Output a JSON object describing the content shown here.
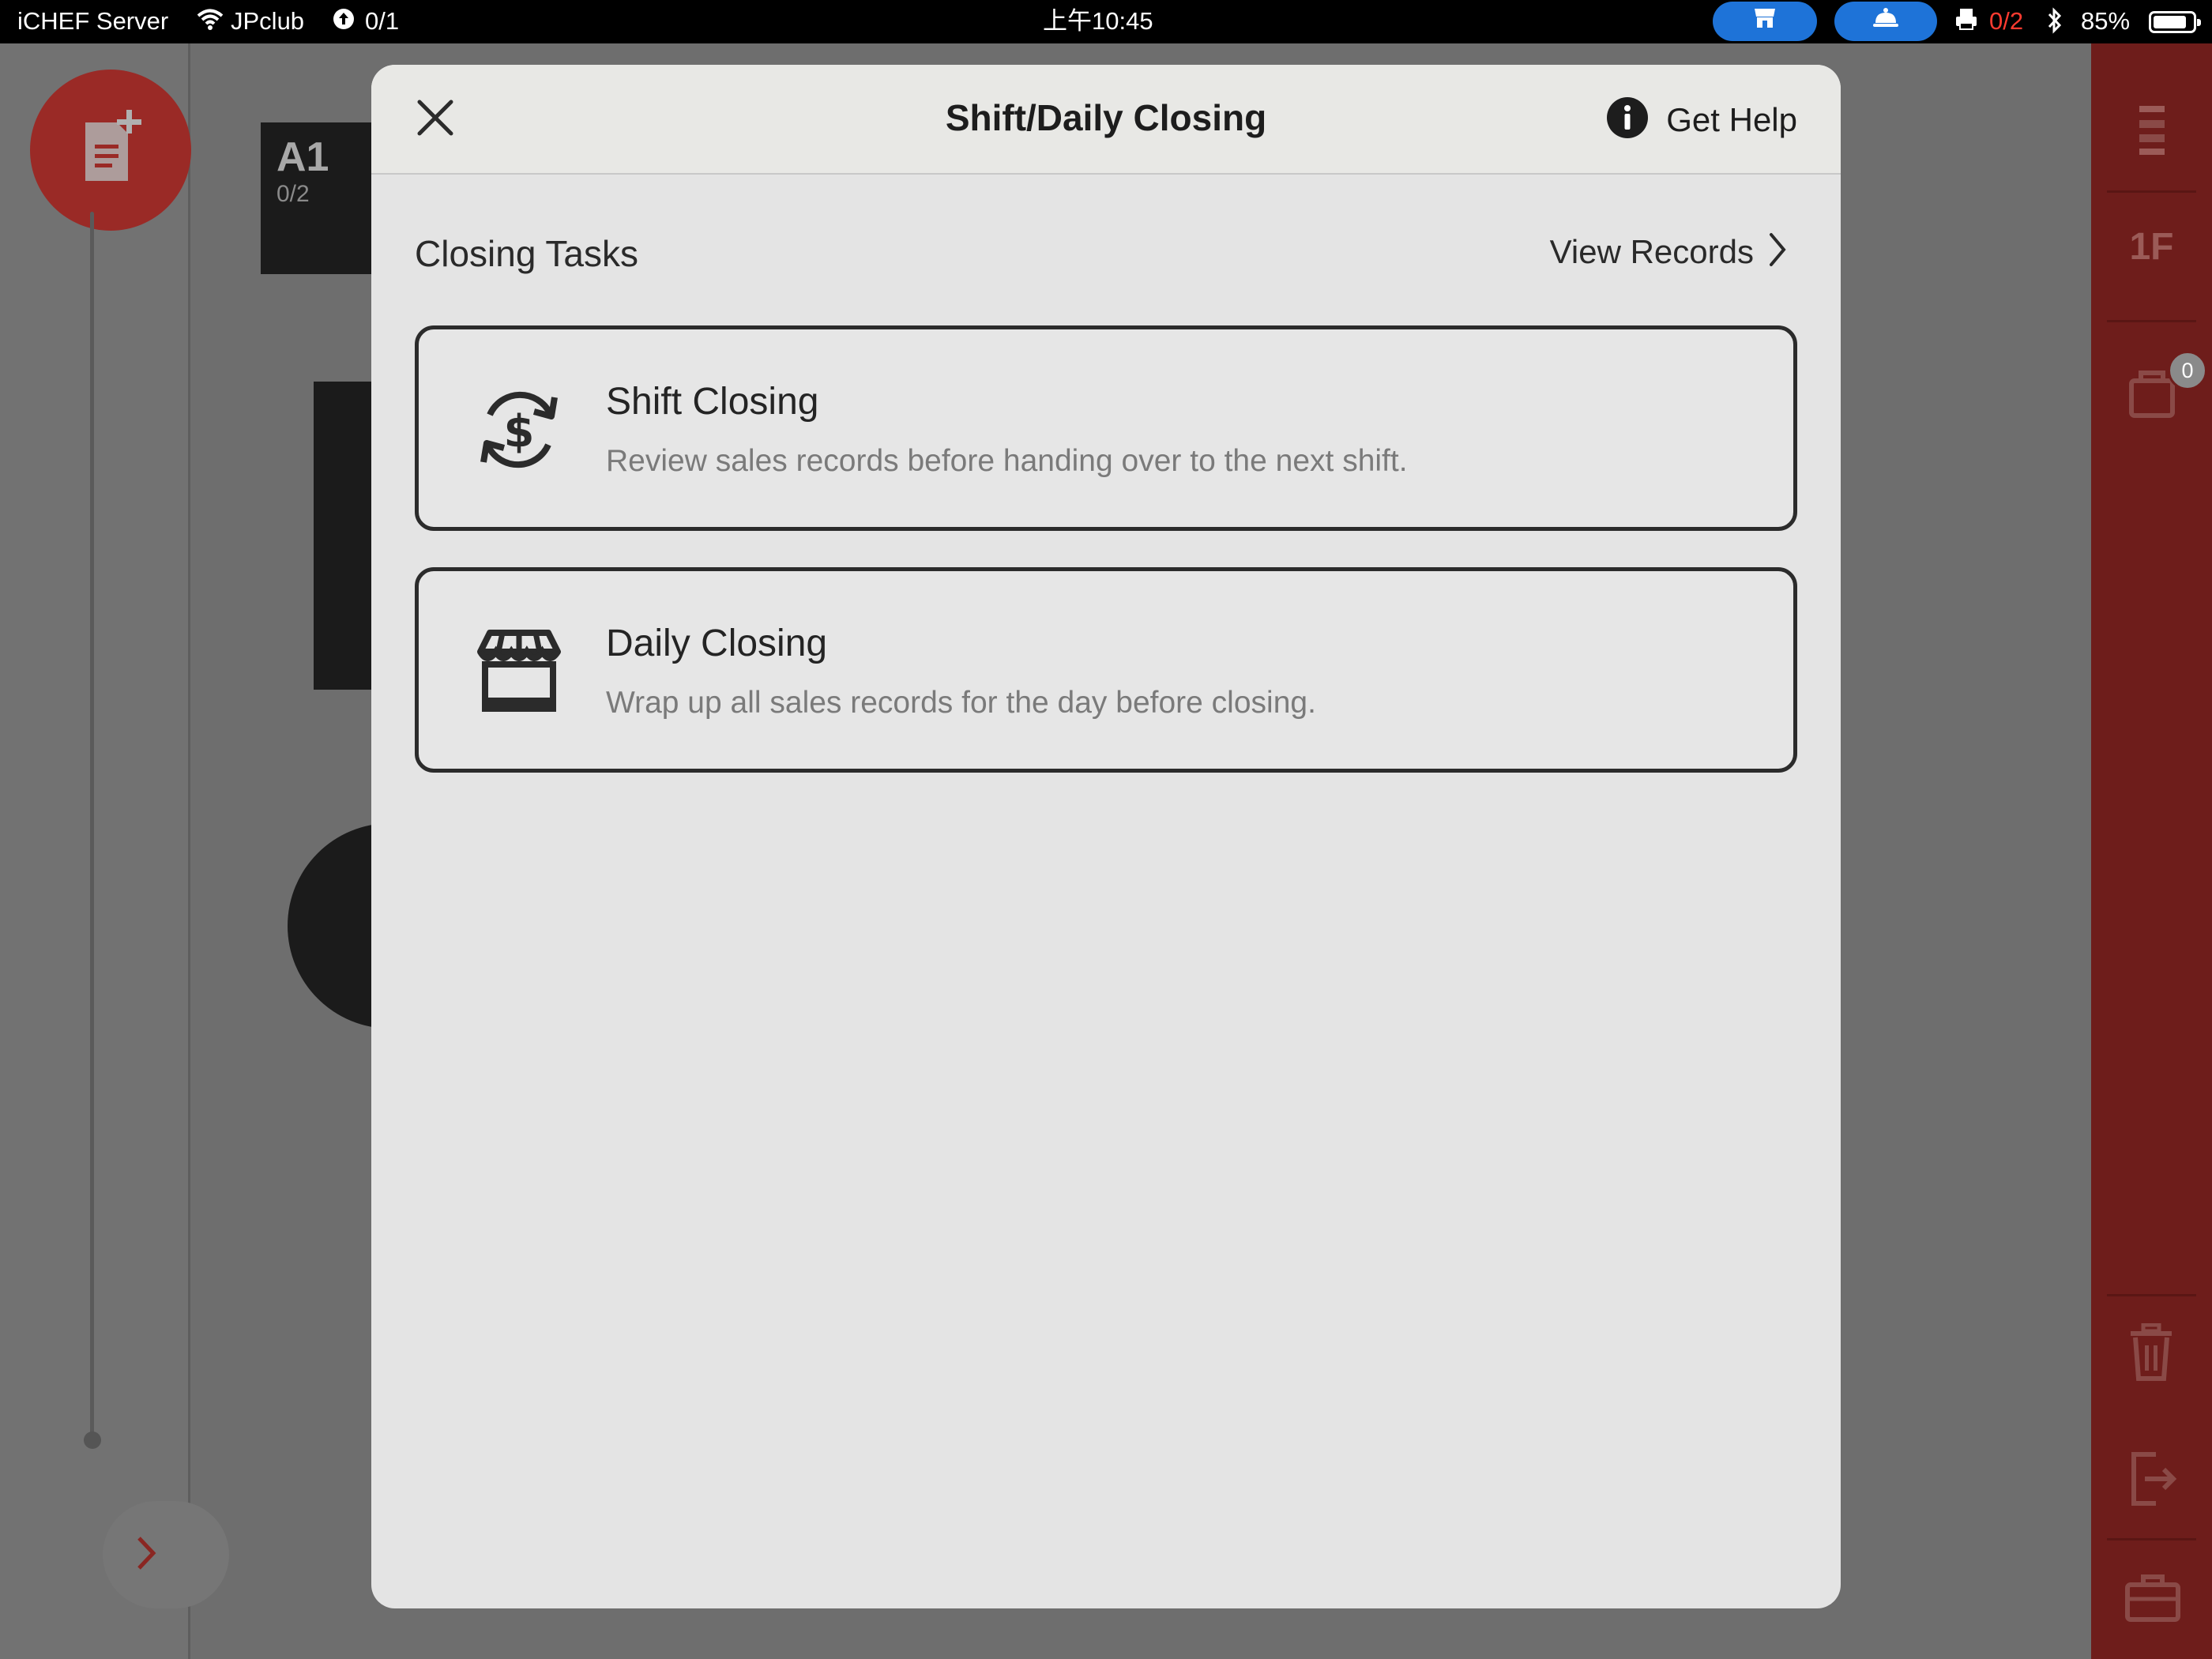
{
  "status_bar": {
    "app_name": "iCHEF Server",
    "network": "JPclub",
    "sync_count": "0/1",
    "time": "上午10:45",
    "printer_count": "0/2",
    "battery": "85%",
    "battery_level": 0.85,
    "accent_red": "#ff3b30",
    "pill_color": "#1e73d8"
  },
  "background": {
    "table_a1_name": "A1",
    "table_a1_count": "0/2",
    "floor": "1F",
    "cart_badge": "0",
    "accent_color": "#9a2a26"
  },
  "modal": {
    "title": "Shift/Daily Closing",
    "help_label": "Get Help",
    "section_title": "Closing Tasks",
    "view_records_label": "View Records",
    "tasks": [
      {
        "title": "Shift Closing",
        "description": "Review sales records before handing over to the next shift.",
        "icon": "dollar-cycle-icon"
      },
      {
        "title": "Daily Closing",
        "description": "Wrap up all sales records for the day before closing.",
        "icon": "storefront-icon"
      }
    ]
  }
}
